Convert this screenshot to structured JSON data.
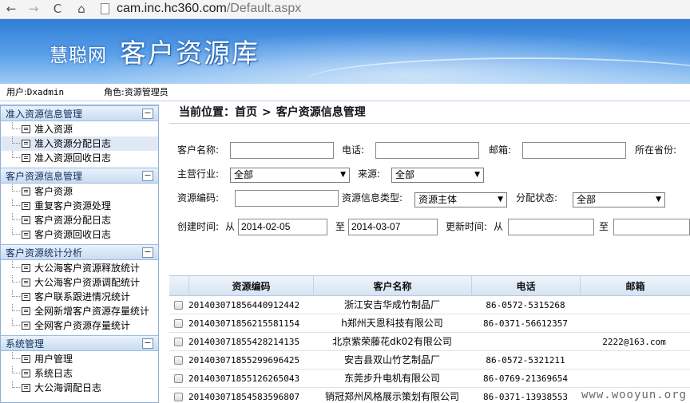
{
  "browser": {
    "url_host": "cam.inc.hc360.com",
    "url_path": "/Default.aspx",
    "back": "←",
    "forward": "→",
    "reload": "C",
    "home": "⌂"
  },
  "header": {
    "brand": "慧聪网",
    "title": "客户资源库"
  },
  "userbar": {
    "user_label": "用户:",
    "user_value": "Dxadmin",
    "role_label": "角色:",
    "role_value": "资源管理员"
  },
  "sidebar": {
    "toggle": "−",
    "groups": [
      {
        "title": "准入资源信息管理",
        "items": [
          "准入资源",
          "准入资源分配日志",
          "准入资源回收日志"
        ]
      },
      {
        "title": "客户资源信息管理",
        "items": [
          "客户资源",
          "重复客户资源处理",
          "客户资源分配日志",
          "客户资源回收日志"
        ]
      },
      {
        "title": "客户资源统计分析",
        "items": [
          "大公海客户资源释放统计",
          "大公海客户资源调配统计",
          "客户联系跟进情况统计",
          "全网新增客户资源存量统计",
          "全网客户资源存量统计"
        ]
      },
      {
        "title": "系统管理",
        "items": [
          "用户管理",
          "系统日志",
          "大公海调配日志"
        ]
      }
    ]
  },
  "breadcrumb": {
    "label": "当前位置：首页",
    "sep": ">",
    "current": "客户资源信息管理"
  },
  "filters": {
    "customer_name_label": "客户名称:",
    "customer_name_value": "",
    "phone_label": "电话:",
    "phone_value": "",
    "email_label": "邮箱:",
    "email_value": "",
    "province_label": "所在省份:",
    "industry_label": "主营行业:",
    "industry_value": "全部",
    "source_label": "来源:",
    "source_value": "全部",
    "resource_code_label": "资源编码:",
    "resource_code_value": "",
    "info_type_label": "资源信息类型:",
    "info_type_value": "资源主体",
    "assign_status_label": "分配状态:",
    "assign_status_value": "全部",
    "create_time_label": "创建时间:",
    "from_label": "从",
    "create_from": "2014-02-05",
    "to_label": "至",
    "create_to": "2014-03-07",
    "update_time_label": "更新时间:",
    "update_from": "",
    "update_to": ""
  },
  "table": {
    "headers": {
      "code": "资源编码",
      "name": "客户名称",
      "phone": "电话",
      "email": "邮箱"
    },
    "rows": [
      {
        "code": "20140307185644091244​2",
        "name": "浙江安吉华成竹制品厂",
        "phone": "86-0572-5315268",
        "email": ""
      },
      {
        "code": "20140307185621558115​4",
        "name": "h郑州天恩科技有限公司",
        "phone": "86-0371-56612357",
        "email": ""
      },
      {
        "code": "20140307185542821413​5",
        "name": "北京紫荣藤花dk02有限公司",
        "phone": "",
        "email": "2222@163.com"
      },
      {
        "code": "20140307185529969642​5",
        "name": "安吉县双山竹艺制品厂",
        "phone": "86-0572-5321211",
        "email": ""
      },
      {
        "code": "20140307185512626504​3",
        "name": "东莞步升电机有限公司",
        "phone": "86-0769-21369654",
        "email": ""
      },
      {
        "code": "20140307185458359680​7",
        "name": "销冠郑州风格展示策划有限公司",
        "phone": "86-0371-13938553",
        "email": ""
      }
    ]
  },
  "watermark": "www.wooyun.org"
}
